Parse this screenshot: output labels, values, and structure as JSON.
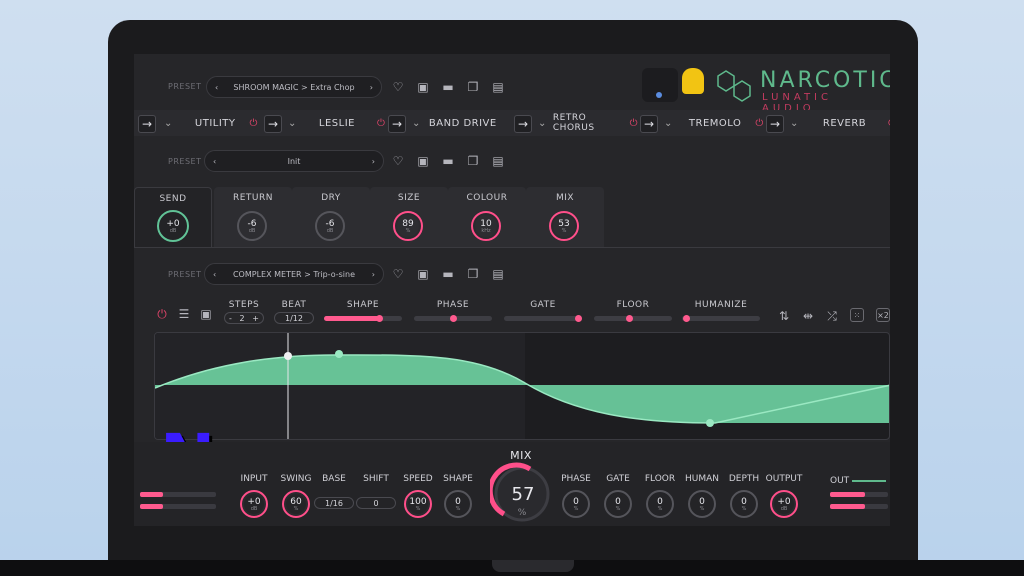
{
  "header": {
    "preset_label": "PRESET",
    "preset_value": "SHROOM MAGIC > Extra Chop",
    "brand_name": "NARCOTIC",
    "brand_sub": "LUNATIC AUDIO"
  },
  "chain": [
    {
      "name": "UTILITY"
    },
    {
      "name": "LESLIE"
    },
    {
      "name": "BAND DRIVE"
    },
    {
      "name": "RETRO CHORUS"
    },
    {
      "name": "TREMOLO"
    },
    {
      "name": "REVERB"
    }
  ],
  "module_preset": {
    "label": "PRESET",
    "value": "Init"
  },
  "fx_tabs": [
    {
      "label": "SEND",
      "value": "+0",
      "unit": "dB"
    },
    {
      "label": "RETURN",
      "value": "-6",
      "unit": "dB"
    },
    {
      "label": "DRY",
      "value": "-6",
      "unit": "dB"
    },
    {
      "label": "SIZE",
      "value": "89",
      "unit": "%"
    },
    {
      "label": "COLOUR",
      "value": "10",
      "unit": "kHz"
    },
    {
      "label": "MIX",
      "value": "53",
      "unit": "%"
    }
  ],
  "lfo_preset": {
    "label": "PRESET",
    "value": "COMPLEX METER > Trip-o-sine"
  },
  "lfo": {
    "steps_label": "STEPS",
    "steps_value": "2",
    "minus": "-",
    "plus": "+",
    "beat_label": "BEAT",
    "beat_value": "1/12",
    "sliders": [
      {
        "label": "SHAPE",
        "fraction": 0.7
      },
      {
        "label": "PHASE",
        "fraction": 0.5
      },
      {
        "label": "GATE",
        "fraction": 0.95
      },
      {
        "label": "FLOOR",
        "fraction": 0.45
      },
      {
        "label": "HUMANIZE",
        "fraction": 0.05
      }
    ]
  },
  "logo_letter": "N",
  "bottom": {
    "mix_label": "MIX",
    "mix_value": "57",
    "mix_unit": "%",
    "base_value": "1/16",
    "shift_value": "0",
    "knobs": [
      {
        "label": "INPUT",
        "value": "+0",
        "unit": "dB",
        "style": "pink"
      },
      {
        "label": "SWING",
        "value": "60",
        "unit": "%",
        "style": "pink"
      },
      {
        "label": "BASE",
        "value": "",
        "unit": "",
        "style": "none"
      },
      {
        "label": "SHIFT",
        "value": "",
        "unit": "",
        "style": "none"
      },
      {
        "label": "SPEED",
        "value": "100",
        "unit": "%",
        "style": "pink"
      },
      {
        "label": "SHAPE",
        "value": "0",
        "unit": "%",
        "style": "grey"
      },
      {
        "label": "PHASE",
        "value": "0",
        "unit": "%",
        "style": "grey"
      },
      {
        "label": "GATE",
        "value": "0",
        "unit": "%",
        "style": "grey"
      },
      {
        "label": "FLOOR",
        "value": "0",
        "unit": "%",
        "style": "grey"
      },
      {
        "label": "HUMAN",
        "value": "0",
        "unit": "%",
        "style": "grey"
      },
      {
        "label": "DEPTH",
        "value": "0",
        "unit": "%",
        "style": "grey"
      },
      {
        "label": "OUTPUT",
        "value": "+0",
        "unit": "dB",
        "style": "pink"
      }
    ],
    "out_label": "OUT",
    "in_meters": [
      0.3,
      0.3
    ],
    "out_meters": [
      0.6,
      0.6
    ]
  },
  "colors": {
    "accent": "#ff4f8a",
    "wave": "#6fd4a3",
    "panel": "#262629"
  }
}
